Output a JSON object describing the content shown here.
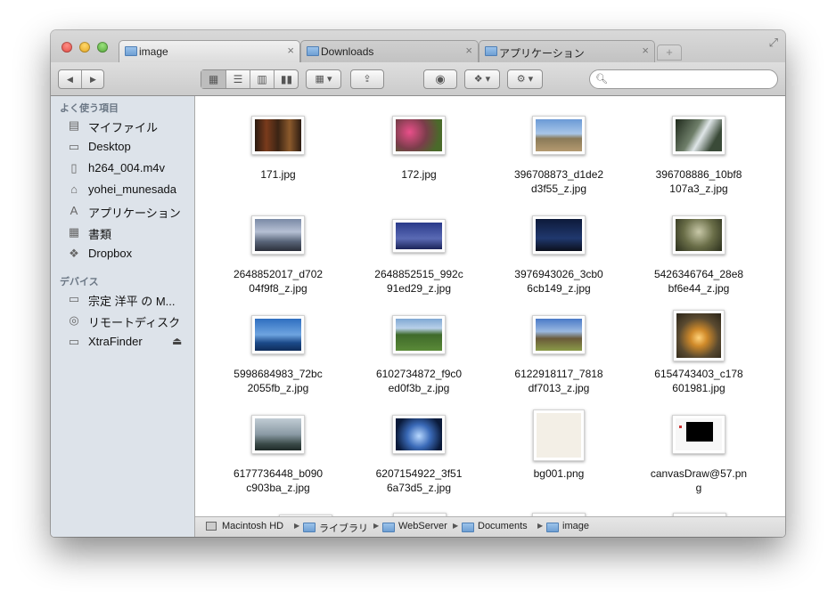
{
  "tabs": [
    {
      "label": "image",
      "close": "×"
    },
    {
      "label": "Downloads",
      "close": "×"
    },
    {
      "label": "アプリケーション",
      "close": "×"
    }
  ],
  "new_tab": "+",
  "toolbar": {
    "back": "◀",
    "forward": "▶",
    "view_icon": "icon-view-icon",
    "view_list": "list-view-icon",
    "view_column": "column-view-icon",
    "view_coverflow": "coverflow-view-icon",
    "arrange": "arrange-icon",
    "share": "share-icon",
    "quicklook": "eye-icon",
    "dropbox": "dropbox-icon",
    "action": "gear-icon",
    "search_placeholder": ""
  },
  "sidebar": {
    "favorites_header": "よく使う項目",
    "favorites": [
      {
        "label": "マイファイル",
        "icon": "all-my-files-icon"
      },
      {
        "label": "Desktop",
        "icon": "desktop-icon"
      },
      {
        "label": "h264_004.m4v",
        "icon": "document-icon"
      },
      {
        "label": "yohei_munesada",
        "icon": "home-icon"
      },
      {
        "label": "アプリケーション",
        "icon": "applications-icon"
      },
      {
        "label": "書類",
        "icon": "documents-icon"
      },
      {
        "label": "Dropbox",
        "icon": "dropbox-icon"
      }
    ],
    "devices_header": "デバイス",
    "devices": [
      {
        "label": "宗定 洋平 の M...",
        "icon": "computer-icon"
      },
      {
        "label": "リモートディスク",
        "icon": "remote-disc-icon"
      },
      {
        "label": "XtraFinder",
        "icon": "drive-icon",
        "eject": "⏏"
      }
    ]
  },
  "files": [
    {
      "name": "171.jpg"
    },
    {
      "name": "172.jpg"
    },
    {
      "name": "396708873_d1de2\nd3f55_z.jpg"
    },
    {
      "name": "396708886_10bf8\n107a3_z.jpg"
    },
    {
      "name": "2648852017_d702\n04f9f8_z.jpg"
    },
    {
      "name": "2648852515_992c\n91ed29_z.jpg"
    },
    {
      "name": "3976943026_3cb0\n6cb149_z.jpg"
    },
    {
      "name": "5426346764_28e8\nbf6e44_z.jpg"
    },
    {
      "name": "5998684983_72bc\n2055fb_z.jpg"
    },
    {
      "name": "6102734872_f9c0\ned0f3b_z.jpg"
    },
    {
      "name": "6122918117_7818\ndf7013_z.jpg"
    },
    {
      "name": "6154743403_c178\n601981.jpg"
    },
    {
      "name": "6177736448_b090\nc903ba_z.jpg"
    },
    {
      "name": "6207154922_3f51\n6a73d5_z.jpg"
    },
    {
      "name": "bg001.png"
    },
    {
      "name": "canvasDraw@57.pn\ng"
    }
  ],
  "pathbar": [
    "Macintosh HD",
    "ライブラリ",
    "WebServer",
    "Documents",
    "image"
  ],
  "colors": {
    "sidebar": "#dde3ea",
    "accent_folder": "#7aa7d8"
  }
}
